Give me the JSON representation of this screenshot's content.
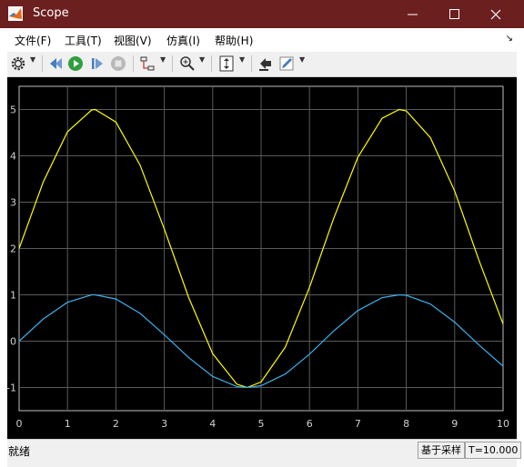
{
  "window": {
    "title": "Scope"
  },
  "menu": [
    "文件(F)",
    "工具(T)",
    "视图(V)",
    "仿真(I)",
    "帮助(H)"
  ],
  "toolbar_icons": [
    "gear-icon",
    "step-back-icon",
    "run-icon",
    "step-forward-icon",
    "stop-icon",
    "signal-selector-icon",
    "zoom-icon",
    "autoscale-icon",
    "highlight-icon",
    "pen-icon"
  ],
  "status": {
    "left": "就绪",
    "mode": "基于采样",
    "time": "T=10.000"
  },
  "colors": {
    "titlebar": "#6b1f1f",
    "plot_bg": "#000000",
    "series1": "#ffff00",
    "series2": "#3daee9",
    "grid": "#5a5a5a",
    "ticks": "#d0d0d0"
  },
  "chart_data": {
    "type": "line",
    "xlim": [
      0,
      10
    ],
    "ylim": [
      -1.5,
      5.5
    ],
    "xticks": [
      0,
      1,
      2,
      3,
      4,
      5,
      6,
      7,
      8,
      9,
      10
    ],
    "yticks": [
      -1,
      0,
      1,
      2,
      3,
      4,
      5
    ],
    "grid": true,
    "series": [
      {
        "color": "#ffff00",
        "x": [
          0,
          0.5,
          1,
          1.5,
          1.571,
          2,
          2.5,
          3,
          3.5,
          4,
          4.5,
          4.712,
          5,
          5.5,
          6,
          6.5,
          7,
          7.5,
          7.854,
          8,
          8.5,
          9,
          9.5,
          10
        ],
        "y": [
          2,
          3.44,
          4.52,
          4.99,
          5,
          4.73,
          3.8,
          2.42,
          0.95,
          -0.27,
          -0.93,
          -1,
          -0.88,
          -0.13,
          1.16,
          2.65,
          3.97,
          4.81,
          5,
          4.97,
          4.39,
          3.24,
          1.75,
          0.37
        ]
      },
      {
        "color": "#3daee9",
        "x": [
          0,
          0.5,
          1,
          1.5,
          1.571,
          2,
          2.5,
          3,
          3.5,
          4,
          4.5,
          4.712,
          5,
          5.5,
          6,
          6.5,
          7,
          7.5,
          7.854,
          8,
          8.5,
          9,
          9.5,
          10
        ],
        "y": [
          0,
          0.48,
          0.84,
          1,
          1,
          0.91,
          0.6,
          0.14,
          -0.35,
          -0.76,
          -0.98,
          -1,
          -0.96,
          -0.71,
          -0.28,
          0.22,
          0.66,
          0.94,
          1,
          0.99,
          0.8,
          0.41,
          -0.08,
          -0.54
        ]
      }
    ]
  }
}
